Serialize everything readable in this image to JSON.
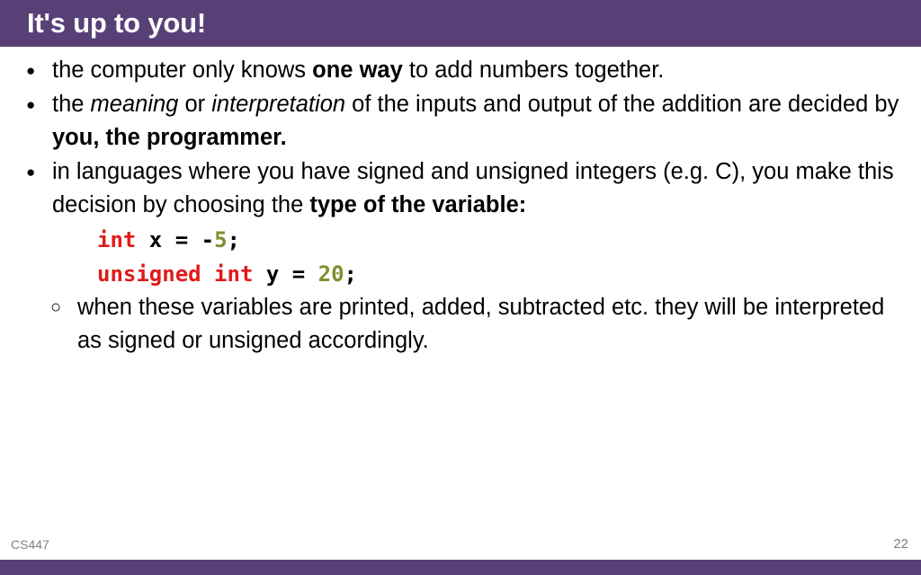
{
  "slide": {
    "title": "It's up to you!",
    "accent_color": "#584077",
    "text_color": "#000000",
    "background_color": "#ffffff"
  },
  "content": {
    "bullet1": {
      "marker": "●",
      "part1": "the computer only knows ",
      "bold1": "one way",
      "part2": " to add numbers together."
    },
    "bullet2": {
      "marker": "●",
      "part1": "the ",
      "italic1": "meaning",
      "part2": " or ",
      "italic2": "interpretation",
      "part3": " of the inputs and output of the addition are decided by ",
      "bold1": "you, the programmer."
    },
    "bullet3": {
      "marker": "●",
      "part1": "in languages where you have signed and unsigned integers (e.g. C), you make this decision by choosing the ",
      "bold1": "type of the variable:"
    },
    "code1": {
      "keyword": "int",
      "middle": " x = -",
      "number": "5",
      "end": ";"
    },
    "code2": {
      "keyword": "unsigned int",
      "middle": " y = ",
      "number": "20",
      "end": ";"
    },
    "sub_bullet1": {
      "marker": "○",
      "text": "when these variables are printed, added, subtracted etc. they will be interpreted as signed or unsigned accordingly."
    }
  },
  "footer": {
    "course": "CS447",
    "page_number": "22"
  }
}
